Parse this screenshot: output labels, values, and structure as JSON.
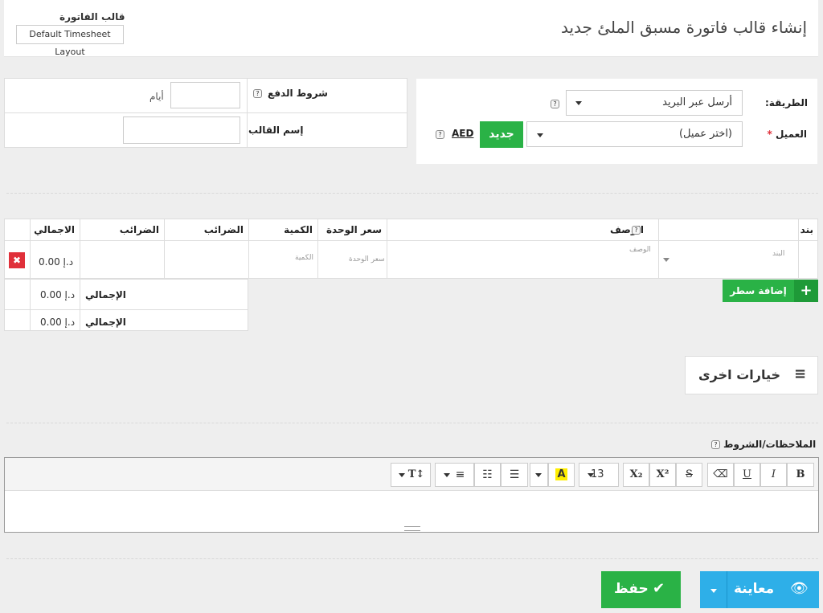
{
  "page": {
    "title": "إنشاء قالب فاتورة مسبق الملئ جديد"
  },
  "template_selector": {
    "label": "قالب الفاتورة",
    "value": "Default Timesheet Layout"
  },
  "method": {
    "label": "الطريقة:",
    "value": "أرسل عبر البريد"
  },
  "client": {
    "label": "العميل",
    "required_mark": "*",
    "placeholder": "(اختر عميل)",
    "new_button": "جديد",
    "currency": "AED"
  },
  "payment_terms": {
    "label": "شروط الدفع",
    "days_label": "أيام",
    "days_value": ""
  },
  "template_name": {
    "label": "إسم القالب",
    "value": ""
  },
  "items_table": {
    "headers": {
      "item": "بند",
      "description": "الوصف",
      "unit_price": "سعر الوحدة",
      "quantity": "الكمية",
      "tax1": "الضرائب",
      "tax2": "الضرائب",
      "total": "الاجمالي"
    },
    "row": {
      "item_placeholder": "البند",
      "description_placeholder": "الوصف",
      "unit_price_placeholder": "سعر الوحدة",
      "quantity_placeholder": "الكمية",
      "total": "0.00 د.إ"
    },
    "add_row": "إضافة سطر"
  },
  "totals": [
    {
      "label": "الإجمالي",
      "value": "0.00 د.إ"
    },
    {
      "label": "الإجمالي",
      "value": "0.00 د.إ"
    }
  ],
  "more_options": {
    "label": "خيارات اخرى"
  },
  "notes": {
    "label": "الملاحظات/الشروط"
  },
  "editor_toolbar": {
    "bold": "B",
    "italic": "I",
    "underline": "U",
    "strike": "S",
    "superscript": "X²",
    "subscript": "X₂",
    "font_size": "13",
    "highlight": "A",
    "heading": "T↕"
  },
  "actions": {
    "preview": "معاينة",
    "save": "حفظ"
  },
  "colors": {
    "green": "#2ab246",
    "blue": "#2eafe8",
    "danger": "#e0303a"
  }
}
